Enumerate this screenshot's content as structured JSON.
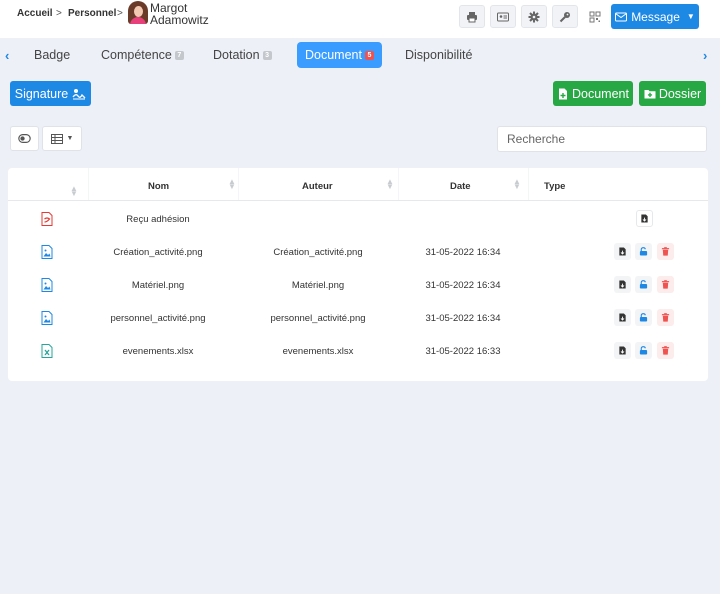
{
  "breadcrumb": {
    "home": "Accueil",
    "sep1": ">",
    "section": "Personnel",
    "sep2": ">",
    "person_first": "Margot",
    "person_last": "Adamowitz"
  },
  "toolbar": {
    "message_label": "Message"
  },
  "tabs": [
    {
      "label": "Badge"
    },
    {
      "label": "Compétence",
      "badge": "7"
    },
    {
      "label": "Dotation",
      "badge": "3"
    },
    {
      "label": "Document",
      "badge": "5"
    },
    {
      "label": "Disponibilité"
    }
  ],
  "actions": {
    "signature_label": "Signature",
    "document_label": "Document",
    "dossier_label": "Dossier"
  },
  "search": {
    "placeholder": "Recherche",
    "value": ""
  },
  "table": {
    "headers": {
      "nom": "Nom",
      "auteur": "Auteur",
      "date": "Date",
      "type": "Type"
    },
    "rows": [
      {
        "icon": "pdf-file-icon",
        "nom": "Reçu adhésion",
        "auteur": "",
        "date": ""
      },
      {
        "icon": "image-file-icon",
        "nom": "Création_activité.png",
        "auteur": "Création_activité.png",
        "date": "31-05-2022 16:34"
      },
      {
        "icon": "image-file-icon",
        "nom": "Matériel.png",
        "auteur": "Matériel.png",
        "date": "31-05-2022 16:34"
      },
      {
        "icon": "image-file-icon",
        "nom": "personnel_activité.png",
        "auteur": "personnel_activité.png",
        "date": "31-05-2022 16:34"
      },
      {
        "icon": "excel-file-icon",
        "nom": "evenements.xlsx",
        "auteur": "evenements.xlsx",
        "date": "31-05-2022 16:33"
      }
    ]
  },
  "colors": {
    "primary": "#1e88e5",
    "active_tab": "#3b9cff",
    "success": "#27a844",
    "danger": "#ef5350",
    "background": "#edf0f7"
  }
}
